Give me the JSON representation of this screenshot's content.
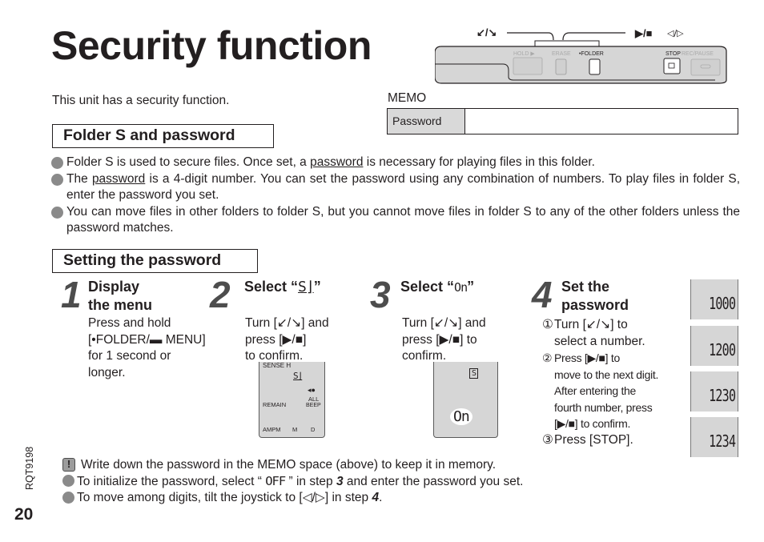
{
  "page": {
    "title": "Security function",
    "intro": "This unit has a security function.",
    "page_number": "20",
    "doc_code": "RQT9198"
  },
  "device": {
    "joystick_label": "↙/↘",
    "play_stop_label": "▶/■",
    "left_right_label": "◁/▷",
    "buttons": [
      "HOLD ▶",
      "ERASE",
      "•FOLDER",
      "STOP",
      "REC/PAUSE"
    ]
  },
  "memo": {
    "label": "MEMO",
    "row_key": "Password",
    "row_value": ""
  },
  "section_folder": {
    "heading": "Folder S and password",
    "bullets": [
      {
        "pre": "Folder S is used to secure files. Once set, a ",
        "link": "password",
        "post": " is necessary for playing files in this folder."
      },
      {
        "pre": "The ",
        "link": "password",
        "post": " is a 4-digit number. You can set the password using any combination of numbers. To play files in folder S, enter the password you set."
      },
      {
        "pre": "You can move files in other folders to folder S, but you cannot move files in folder S to any of the other folders unless the password matches.",
        "link": "",
        "post": ""
      }
    ]
  },
  "section_password": {
    "heading": "Setting the password",
    "steps": [
      {
        "number": "1",
        "title_line1": "Display",
        "title_line2": "the menu",
        "body": [
          "Press and hold",
          "[•FOLDER/▬ MENU]",
          "for 1 second or",
          "longer."
        ]
      },
      {
        "number": "2",
        "title": "Select “",
        "glyph": "S⌋",
        "title_end": "”",
        "body": [
          "Turn [↙/↘] and",
          "press [▶/■]",
          "to confirm."
        ],
        "lcd": {
          "top": "SENSE H",
          "icon": "S⌋",
          "remain": "REMAIN",
          "beep1": "ALL",
          "beep2": "BEEP",
          "ampm": "AMPM",
          "m": "M",
          "d": "D"
        }
      },
      {
        "number": "3",
        "title": "Select “",
        "glyph": "On",
        "title_end": "”",
        "body": [
          "Turn [↙/↘] and",
          "press [▶/■] to",
          "confirm."
        ],
        "lcd": {
          "icon": "S",
          "value": "On"
        }
      },
      {
        "number": "4",
        "title_line1": "Set the",
        "title_line2": "password",
        "sub": [
          {
            "mark": "①",
            "lines": [
              "Turn [↙/↘] to",
              "select a number."
            ]
          },
          {
            "mark": "②",
            "lines": [
              "Press [▶/■] to",
              "move to the next digit.",
              "After entering the",
              "fourth number, press",
              "[▶/■] to confirm."
            ]
          },
          {
            "mark": "③",
            "lines": [
              "Press [STOP]."
            ]
          }
        ],
        "displays": [
          "1000",
          "1200",
          "1230",
          "1234"
        ]
      }
    ]
  },
  "notes": [
    {
      "type": "caution",
      "icon": "!",
      "text": "Write down the password in the MEMO space (above) to keep it in memory."
    },
    {
      "type": "bullet",
      "pre": "To initialize the password, select “ ",
      "glyph": "OFF",
      "mid": " ” in step ",
      "bold": "3",
      "post": " and enter the password you set."
    },
    {
      "type": "bullet",
      "pre": "To move among digits, tilt the joystick to [◁/▷] in step ",
      "bold": "4",
      "post": "."
    }
  ]
}
